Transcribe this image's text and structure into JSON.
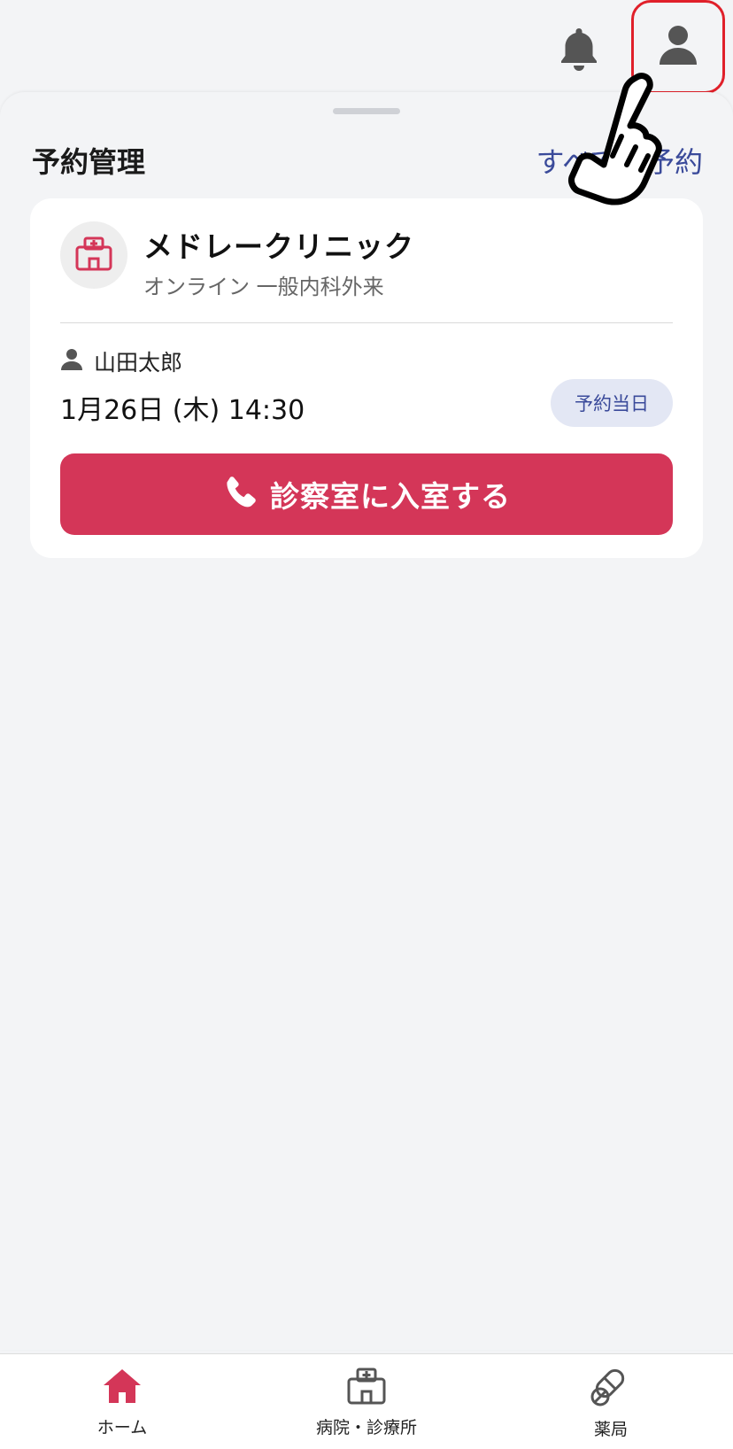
{
  "topbar": {
    "bell_icon": "bell-icon",
    "profile_icon": "person-icon",
    "highlight_color": "#e0202a"
  },
  "sheet": {
    "title": "予約管理",
    "link": "すべての予約"
  },
  "appointment": {
    "clinic_name": "メドレークリニック",
    "clinic_subtitle": "オンライン 一般内科外来",
    "patient_name": "山田太郎",
    "datetime": "1月26日 (木) 14:30",
    "badge": "予約当日",
    "enter_button": "診察室に入室する",
    "accent_color": "#d43658"
  },
  "bottom_nav": {
    "items": [
      {
        "label": "ホーム",
        "icon": "home-icon",
        "active": true
      },
      {
        "label": "病院・診療所",
        "icon": "hospital-icon",
        "active": false
      },
      {
        "label": "薬局",
        "icon": "pill-icon",
        "active": false
      }
    ]
  }
}
